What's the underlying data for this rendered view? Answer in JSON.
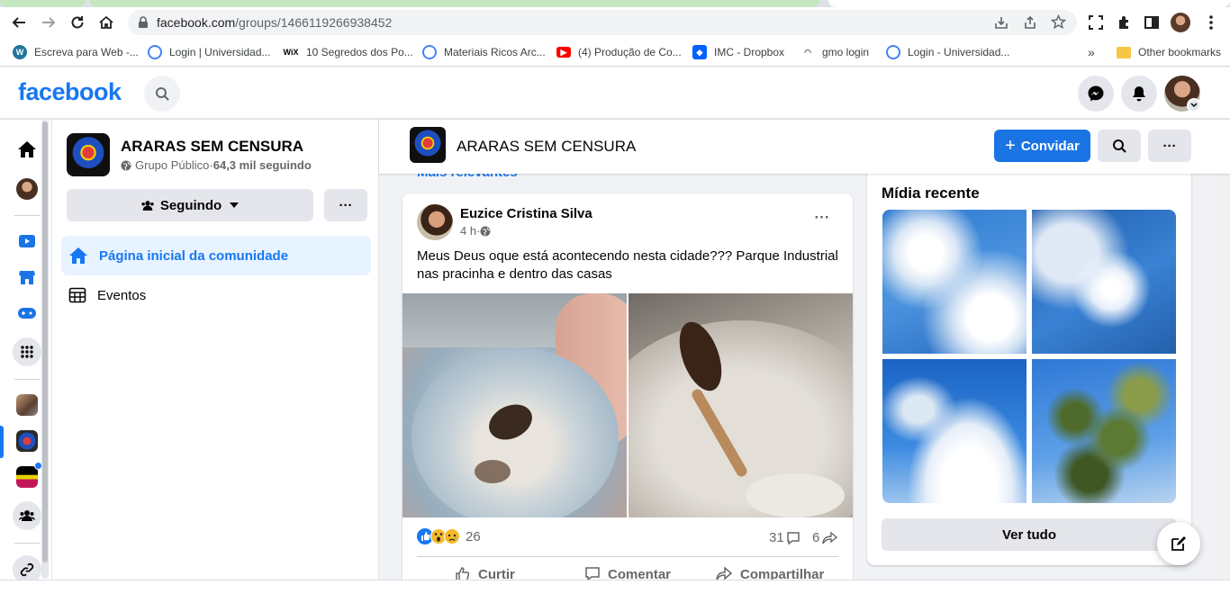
{
  "browser": {
    "url_host": "facebook.com",
    "url_path": "/groups/1466119266938452",
    "bookmarks": [
      {
        "label": "Escreva para Web -...",
        "icon": "wordpress-icon"
      },
      {
        "label": "Login | Universidad...",
        "icon": "page-icon"
      },
      {
        "label": "10 Segredos dos Po...",
        "icon": "wix-icon"
      },
      {
        "label": "Materiais Ricos Arc...",
        "icon": "page-icon"
      },
      {
        "label": "(4) Produção de Co...",
        "icon": "youtube-icon"
      },
      {
        "label": "IMC - Dropbox",
        "icon": "dropbox-icon"
      },
      {
        "label": "gmo login",
        "icon": "gmo-icon"
      },
      {
        "label": "Login - Universidad...",
        "icon": "page-icon"
      }
    ],
    "overflow": "»",
    "other_bookmarks": "Other bookmarks"
  },
  "header": {
    "logo": "facebook"
  },
  "sidebar": {
    "group_name": "ARARAS SEM CENSURA",
    "group_meta_privacy": "Grupo Público",
    "group_meta_sep": " · ",
    "group_meta_members": "64,3 mil seguindo",
    "following_label": "Seguindo",
    "more_label": "···",
    "nav": [
      {
        "label": "Página inicial da comunidade",
        "active": true
      },
      {
        "label": "Eventos",
        "active": false
      }
    ]
  },
  "subheader": {
    "group_name": "ARARAS SEM CENSURA",
    "invite_label": "Convidar",
    "invite_prefix": "+",
    "more_label": "···",
    "sort_label": "Mais relevantes"
  },
  "post": {
    "author": "Euzice Cristina Silva",
    "time": "4 h",
    "time_sep": " · ",
    "text": "Meus Deus oque está acontecendo nesta cidade??? Parque Industrial nas pracinha e dentro das casas",
    "reaction_count": "26",
    "comment_count": "31",
    "share_count": "6",
    "actions": {
      "like": "Curtir",
      "comment": "Comentar",
      "share": "Compartilhar"
    }
  },
  "media": {
    "title": "Mídia recente",
    "see_all": "Ver tudo"
  },
  "colors": {
    "brand": "#1877f2",
    "active_nav_bg": "#e7f3ff",
    "button_gray": "#e4e6eb",
    "invite_blue": "#1b74e4"
  }
}
